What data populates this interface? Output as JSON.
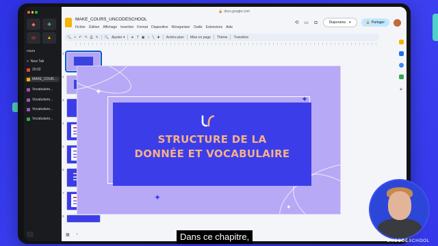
{
  "browser": {
    "url": "docs.google.com",
    "space_label": "cours",
    "new_tab_label": "New Tab",
    "timer": "20:02",
    "tabs": [
      {
        "label": "MAKE_COUR...",
        "selected": true
      },
      {
        "label": "Vocabulaire..."
      },
      {
        "label": "Vocabulaire..."
      },
      {
        "label": "Vocabulaire..."
      },
      {
        "label": "Vocabulaire..."
      }
    ]
  },
  "slides_app": {
    "doc_title": "MAKE_COURS_UNCODESCHOOL",
    "menus": [
      "Fichier",
      "Édition",
      "Affichage",
      "Insertion",
      "Format",
      "Diapositive",
      "Réorganiser",
      "Outils",
      "Extensions",
      "Aide"
    ],
    "diaporama_label": "Diaporama",
    "share_label": "Partager",
    "toolbar": {
      "fit_label": "Ajuster",
      "background_label": "Arrière-plan",
      "layout_label": "Mise en page",
      "theme_label": "Thème",
      "transition_label": "Transition"
    },
    "slide_numbers": [
      "1",
      "2",
      "3",
      "4",
      "5",
      "6",
      "7",
      "8"
    ],
    "slide": {
      "title_line1": "STRUCTURE DE LA",
      "title_line2": "DONNÉE ET VOCABULAIRE",
      "background_color": "#b8a9f6",
      "panel_color": "#3b3ee8",
      "title_color": "#f5b08a"
    }
  },
  "overlay": {
    "subtitle": "Dans ce chapitre,",
    "brand": "UNCODESCHOOL",
    "brand_uncode": "UNCODE",
    "brand_school": "SCHOOL"
  },
  "colors": {
    "page_bg": "#3b3ff0",
    "accent_teal": "#4fd1c5",
    "selection_blue": "#0b57d0"
  }
}
